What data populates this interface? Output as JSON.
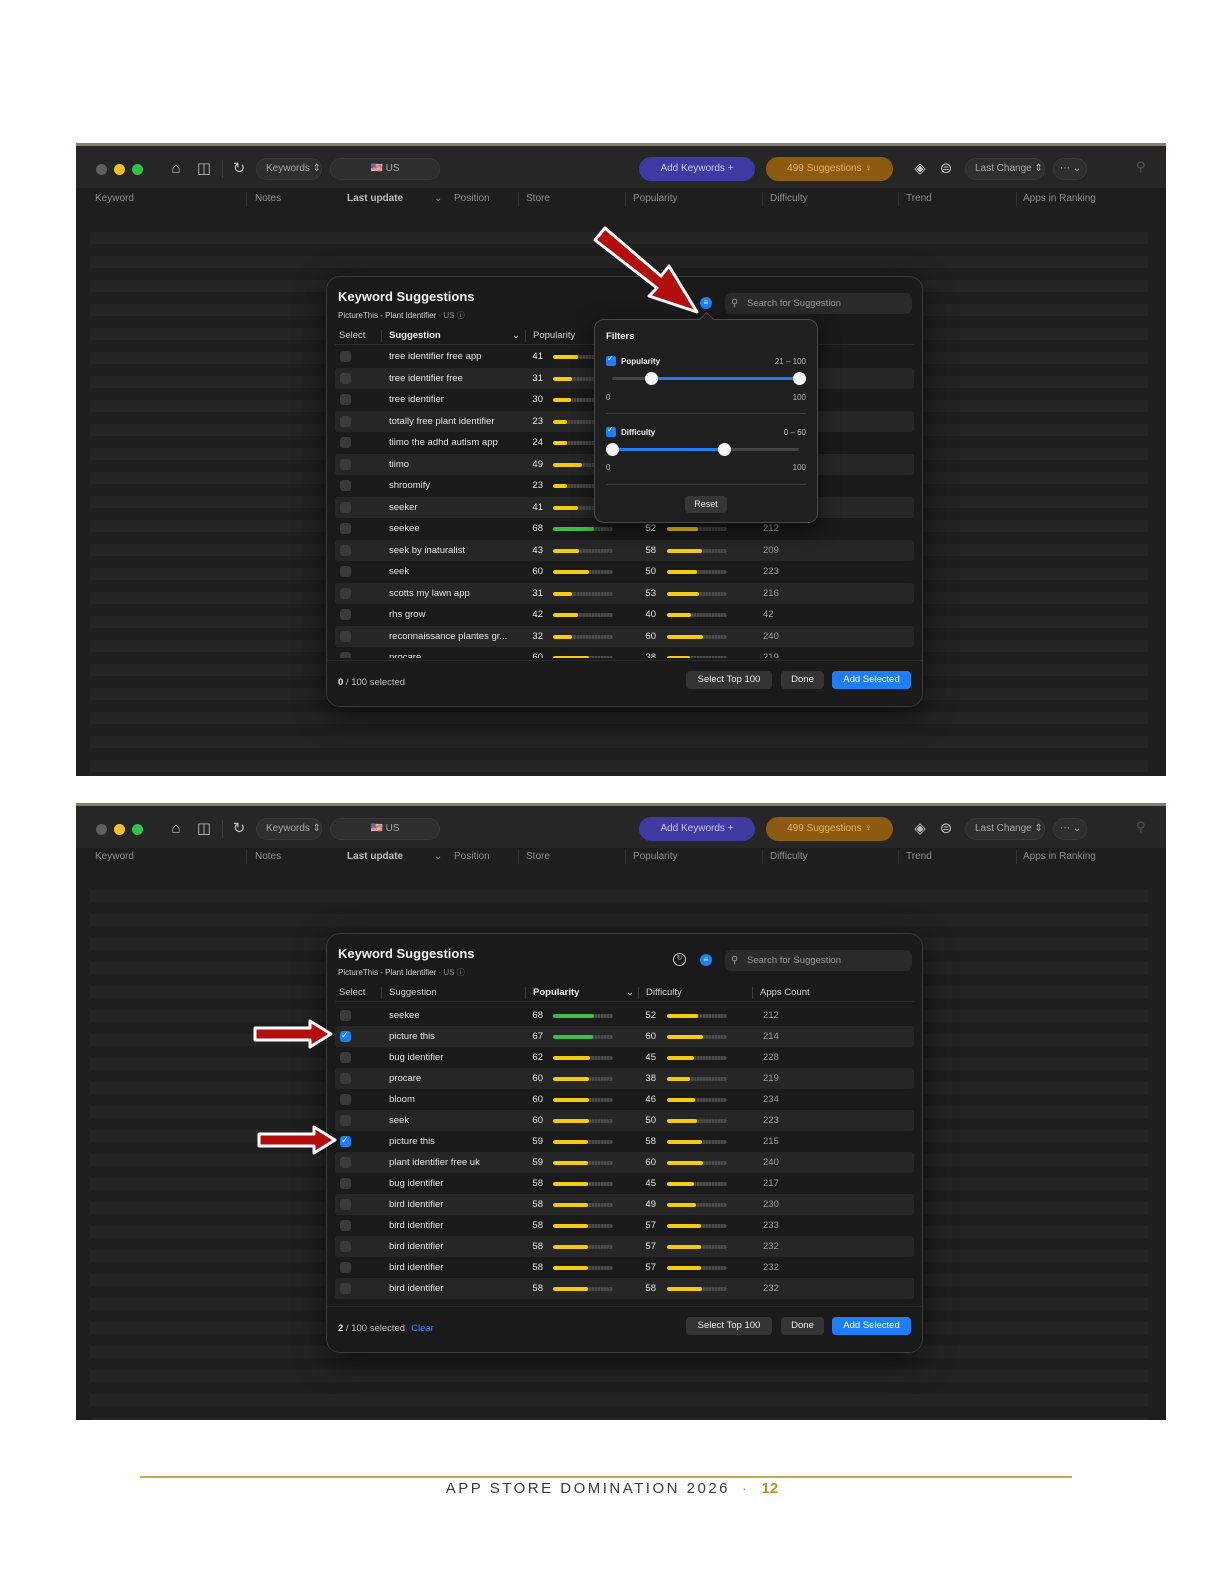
{
  "toolbar": {
    "keywords_selector": "Keywords ⇕",
    "country": "🇺🇸 US",
    "add_keywords": "Add Keywords  +",
    "suggestions_count": "499 Suggestions  ♀",
    "sort_selector": "Last Change ⇕",
    "more_menu": "⋯ ⌄"
  },
  "columns": {
    "keyword": "Keyword",
    "notes": "Notes",
    "last_update": "Last update",
    "position": "Position",
    "store": "Store",
    "popularity": "Popularity",
    "difficulty": "Difficulty",
    "trend": "Trend",
    "apps_in_ranking": "Apps in Ranking"
  },
  "dialog": {
    "title": "Keyword Suggestions",
    "app_name": "PictureThis - Plant Identifier",
    "country": "US",
    "search_placeholder": "Search for Suggestion",
    "col_select": "Select",
    "col_suggestion": "Suggestion",
    "col_popularity": "Popularity",
    "col_difficulty": "Difficulty",
    "col_apps_count": "Apps Count",
    "select_top": "Select Top 100",
    "done": "Done",
    "add_selected": "Add Selected",
    "clear": "Clear"
  },
  "filters": {
    "title": "Filters",
    "popularity_label": "Popularity",
    "popularity_range": "21 – 100",
    "popularity_min": 21,
    "popularity_max": 100,
    "difficulty_label": "Difficulty",
    "difficulty_range": "0 – 60",
    "difficulty_min": 0,
    "difficulty_max": 60,
    "scale_min": "0",
    "scale_max": "100",
    "reset": "Reset"
  },
  "panel1": {
    "selected_count": "0",
    "selected_total": " / 100 selected",
    "rows": [
      {
        "kw": "tree identifier free app",
        "pop": "41",
        "pop_v": 41
      },
      {
        "kw": "tree identifier free",
        "pop": "31",
        "pop_v": 31
      },
      {
        "kw": "tree identifier",
        "pop": "30",
        "pop_v": 30
      },
      {
        "kw": "totally free plant identifier",
        "pop": "23",
        "pop_v": 23
      },
      {
        "kw": "tiimo the adhd autism app",
        "pop": "24",
        "pop_v": 24
      },
      {
        "kw": "tiimo",
        "pop": "49",
        "pop_v": 49
      },
      {
        "kw": "shroomify",
        "pop": "23",
        "pop_v": 23
      },
      {
        "kw": "seeker",
        "pop": "41",
        "pop_v": 41
      },
      {
        "kw": "seekee",
        "pop": "68",
        "pop_v": 68,
        "diff": "52",
        "diff_v": 52,
        "apps": "212"
      },
      {
        "kw": "seek by inaturalist",
        "pop": "43",
        "pop_v": 43,
        "diff": "58",
        "diff_v": 58,
        "apps": "209"
      },
      {
        "kw": "seek",
        "pop": "60",
        "pop_v": 60,
        "diff": "50",
        "diff_v": 50,
        "apps": "223"
      },
      {
        "kw": "scotts my lawn app",
        "pop": "31",
        "pop_v": 31,
        "diff": "53",
        "diff_v": 53,
        "apps": "216"
      },
      {
        "kw": "rhs grow",
        "pop": "42",
        "pop_v": 42,
        "diff": "40",
        "diff_v": 40,
        "apps": "42"
      },
      {
        "kw": "reconnaissance plantes gr...",
        "pop": "32",
        "pop_v": 32,
        "diff": "60",
        "diff_v": 60,
        "apps": "240"
      },
      {
        "kw": "procare",
        "pop": "60",
        "pop_v": 60,
        "diff": "38",
        "diff_v": 38,
        "apps": "219"
      }
    ]
  },
  "panel2": {
    "selected_count": "2",
    "selected_total": " / 100 selected",
    "rows": [
      {
        "kw": "seekee",
        "pop": "68",
        "pop_v": 68,
        "diff": "52",
        "diff_v": 52,
        "apps": "212",
        "checked": false
      },
      {
        "kw": "picture  this",
        "pop": "67",
        "pop_v": 67,
        "diff": "60",
        "diff_v": 60,
        "apps": "214",
        "checked": true
      },
      {
        "kw": "bug identifier",
        "pop": "62",
        "pop_v": 62,
        "diff": "45",
        "diff_v": 45,
        "apps": "228",
        "checked": false
      },
      {
        "kw": "procare",
        "pop": "60",
        "pop_v": 60,
        "diff": "38",
        "diff_v": 38,
        "apps": "219",
        "checked": false
      },
      {
        "kw": "bloom",
        "pop": "60",
        "pop_v": 60,
        "diff": "46",
        "diff_v": 46,
        "apps": "234",
        "checked": false
      },
      {
        "kw": "seek",
        "pop": "60",
        "pop_v": 60,
        "diff": "50",
        "diff_v": 50,
        "apps": "223",
        "checked": false
      },
      {
        "kw": "picture this",
        "pop": "59",
        "pop_v": 59,
        "diff": "58",
        "diff_v": 58,
        "apps": "215",
        "checked": true
      },
      {
        "kw": "plant identifier free uk",
        "pop": "59",
        "pop_v": 59,
        "diff": "60",
        "diff_v": 60,
        "apps": "240",
        "checked": false
      },
      {
        "kw": "bug identifier",
        "pop": "58",
        "pop_v": 58,
        "diff": "45",
        "diff_v": 45,
        "apps": "217",
        "checked": false
      },
      {
        "kw": "bird identifier",
        "pop": "58",
        "pop_v": 58,
        "diff": "49",
        "diff_v": 49,
        "apps": "230",
        "checked": false
      },
      {
        "kw": "bird identifier",
        "pop": "58",
        "pop_v": 58,
        "diff": "57",
        "diff_v": 57,
        "apps": "233",
        "checked": false
      },
      {
        "kw": "bird identifier",
        "pop": "58",
        "pop_v": 58,
        "diff": "57",
        "diff_v": 57,
        "apps": "232",
        "checked": false
      },
      {
        "kw": "bird identifier",
        "pop": "58",
        "pop_v": 58,
        "diff": "57",
        "diff_v": 57,
        "apps": "232",
        "checked": false
      },
      {
        "kw": "bird identifier",
        "pop": "58",
        "pop_v": 58,
        "diff": "58",
        "diff_v": 58,
        "apps": "232",
        "checked": false
      }
    ]
  },
  "colors": {
    "accent_blue": "#1f7ef5",
    "bar_yellow": "#f5cb0f",
    "bar_green": "#3fbc4a",
    "arrow_red": "#b30d0d",
    "footer_gold": "#c9a94d"
  },
  "footer": {
    "title": "APP STORE DOMINATION 2026",
    "separator": "·",
    "page": "12"
  }
}
